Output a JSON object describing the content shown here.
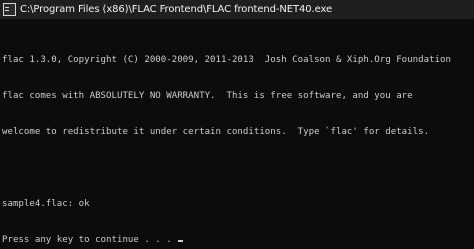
{
  "window": {
    "title": "C:\\Program Files (x86)\\FLAC Frontend\\FLAC frontend-NET40.exe",
    "icon": "console-app-icon"
  },
  "console": {
    "lines": [
      "flac 1.3.0, Copyright (C) 2000-2009, 2011-2013  Josh Coalson & Xiph.Org Foundation",
      "flac comes with ABSOLUTELY NO WARRANTY.  This is free software, and you are",
      "welcome to redistribute it under certain conditions.  Type `flac' for details.",
      "",
      "sample4.flac: ok",
      "Press any key to continue . . . "
    ]
  },
  "colors": {
    "background": "#0c0c0c",
    "titlebar": "#1f1f1f",
    "text": "#cccccc",
    "title_text": "#f2f2f2"
  }
}
